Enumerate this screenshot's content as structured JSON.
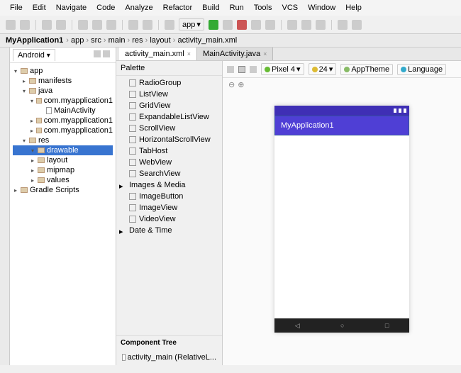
{
  "menu": [
    "File",
    "Edit",
    "Navigate",
    "Code",
    "Analyze",
    "Refactor",
    "Build",
    "Run",
    "Tools",
    "VCS",
    "Window",
    "Help"
  ],
  "toolbar_app": "app",
  "breadcrumb": {
    "root": "MyApplication1",
    "parts": [
      "app",
      "src",
      "main",
      "res",
      "layout",
      "activity_main.xml"
    ]
  },
  "project_panel": {
    "tab": "Android",
    "tree": [
      {
        "lvl": 0,
        "type": "arrow",
        "open": true,
        "icon": "folder",
        "label": "app"
      },
      {
        "lvl": 1,
        "type": "arrow",
        "open": false,
        "icon": "folder",
        "label": "manifests"
      },
      {
        "lvl": 1,
        "type": "arrow",
        "open": true,
        "icon": "folder",
        "label": "java"
      },
      {
        "lvl": 2,
        "type": "arrow",
        "open": true,
        "icon": "folder",
        "label": "com.myapplication1"
      },
      {
        "lvl": 3,
        "type": "none",
        "icon": "file",
        "label": "MainActivity"
      },
      {
        "lvl": 2,
        "type": "arrow",
        "open": false,
        "icon": "folder",
        "label": "com.myapplication1"
      },
      {
        "lvl": 2,
        "type": "arrow",
        "open": false,
        "icon": "folder",
        "label": "com.myapplication1"
      },
      {
        "lvl": 1,
        "type": "arrow",
        "open": true,
        "icon": "folder",
        "label": "res"
      },
      {
        "lvl": 2,
        "type": "arrow",
        "open": true,
        "icon": "folder",
        "label": "drawable",
        "sel": true
      },
      {
        "lvl": 2,
        "type": "arrow",
        "open": false,
        "icon": "folder",
        "label": "layout"
      },
      {
        "lvl": 2,
        "type": "arrow",
        "open": false,
        "icon": "folder",
        "label": "mipmap"
      },
      {
        "lvl": 2,
        "type": "arrow",
        "open": false,
        "icon": "folder",
        "label": "values"
      },
      {
        "lvl": 0,
        "type": "arrow",
        "open": false,
        "icon": "folder",
        "label": "Gradle Scripts"
      }
    ]
  },
  "editor_tabs": [
    {
      "label": "activity_main.xml",
      "active": true
    },
    {
      "label": "MainActivity.java",
      "active": false
    }
  ],
  "palette": {
    "title": "Palette",
    "items": [
      {
        "kind": "item",
        "label": "RadioGroup"
      },
      {
        "kind": "item",
        "label": "ListView"
      },
      {
        "kind": "item",
        "label": "GridView"
      },
      {
        "kind": "item",
        "label": "ExpandableListView"
      },
      {
        "kind": "item",
        "label": "ScrollView"
      },
      {
        "kind": "item",
        "label": "HorizontalScrollView"
      },
      {
        "kind": "item",
        "label": "TabHost"
      },
      {
        "kind": "item",
        "label": "WebView"
      },
      {
        "kind": "item",
        "label": "SearchView"
      },
      {
        "kind": "group",
        "label": "Images & Media"
      },
      {
        "kind": "item",
        "label": "ImageButton"
      },
      {
        "kind": "item",
        "label": "ImageView"
      },
      {
        "kind": "item",
        "label": "VideoView"
      },
      {
        "kind": "group",
        "label": "Date & Time"
      }
    ],
    "component_tree_title": "Component Tree",
    "component_tree_item": "activity_main (RelativeL..."
  },
  "preview_toolbar": {
    "device": "Pixel 4",
    "api": "24",
    "theme": "AppTheme",
    "lang": "Language"
  },
  "device": {
    "app_title": "MyApplication1"
  }
}
